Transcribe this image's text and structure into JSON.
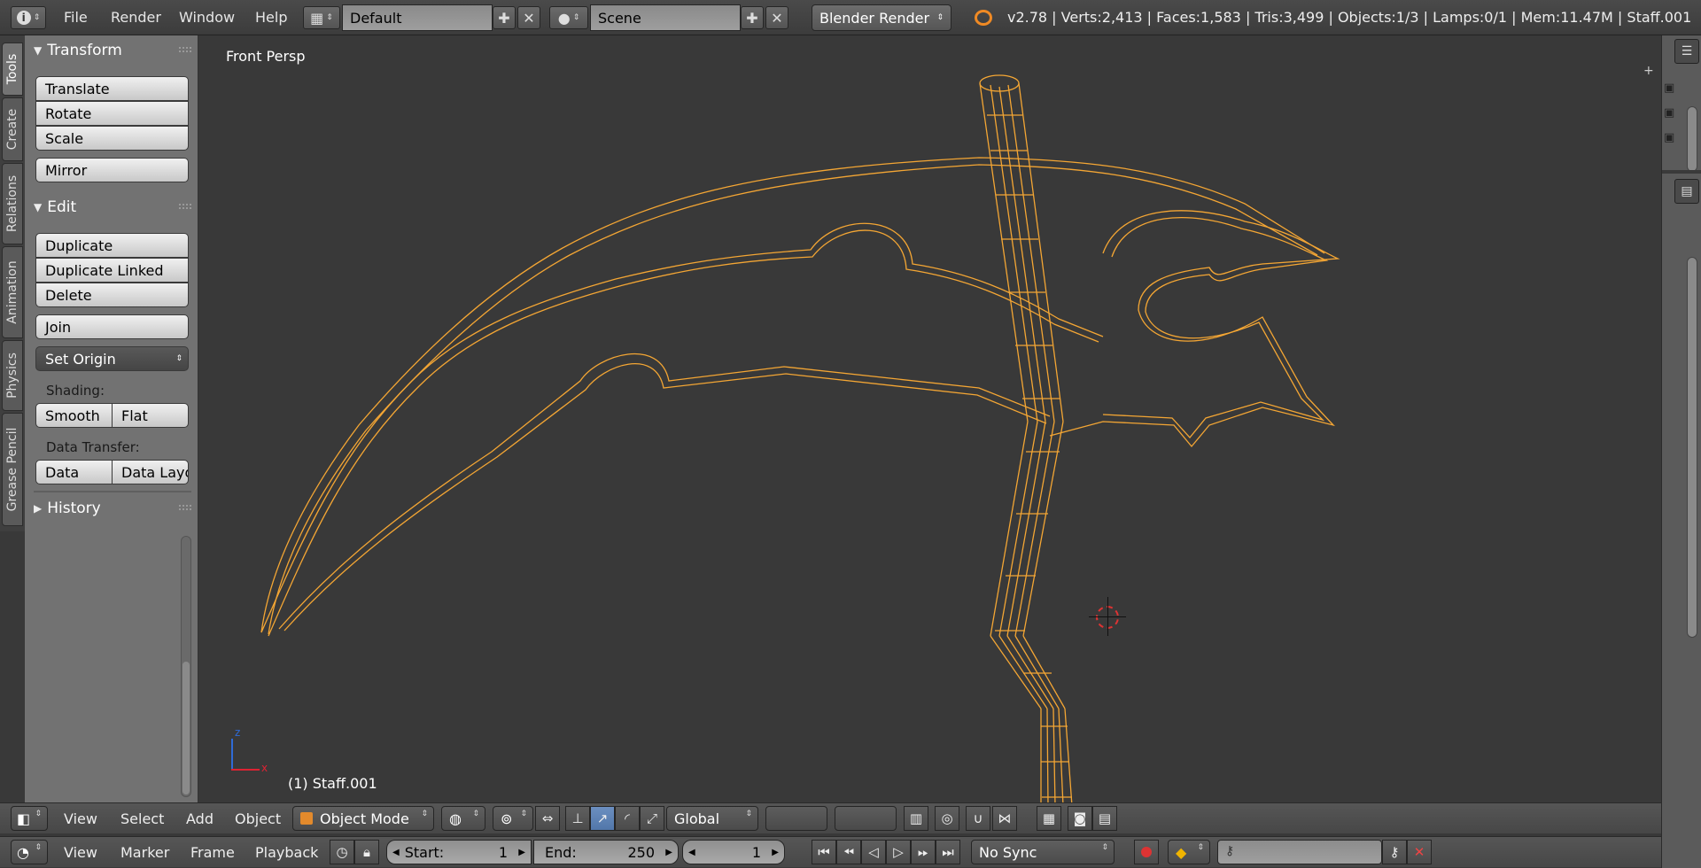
{
  "topbar": {
    "menus": [
      "File",
      "Render",
      "Window",
      "Help"
    ],
    "layout_name": "Default",
    "scene_name": "Scene",
    "render_engine": "Blender Render",
    "stats": "v2.78 | Verts:2,413 | Faces:1,583 | Tris:3,499 | Objects:1/3 | Lamps:0/1 | Mem:11.47M | Staff.001"
  },
  "lefttabs": [
    "Tools",
    "Create",
    "Relations",
    "Animation",
    "Physics",
    "Grease Pencil"
  ],
  "toolshelf": {
    "transform_title": "Transform",
    "translate": "Translate",
    "rotate": "Rotate",
    "scale": "Scale",
    "mirror": "Mirror",
    "edit_title": "Edit",
    "duplicate": "Duplicate",
    "duplicate_linked": "Duplicate Linked",
    "delete": "Delete",
    "join": "Join",
    "set_origin": "Set Origin",
    "shading_label": "Shading:",
    "smooth": "Smooth",
    "flat": "Flat",
    "data_transfer_label": "Data Transfer:",
    "data": "Data",
    "data_layout": "Data Layo",
    "history_title": "History"
  },
  "viewport": {
    "view_label": "Front Persp",
    "object_label": "(1) Staff.001",
    "axis_z": "z",
    "axis_x": "x",
    "wire_color": "#f4a634"
  },
  "view3d_header": {
    "menus": [
      "View",
      "Select",
      "Add",
      "Object"
    ],
    "mode": "Object Mode",
    "orientation": "Global"
  },
  "timeline": {
    "menus": [
      "View",
      "Marker",
      "Frame",
      "Playback"
    ],
    "start_label": "Start:",
    "start_value": "1",
    "end_label": "End:",
    "end_value": "250",
    "current_frame": "1",
    "sync": "No Sync"
  }
}
